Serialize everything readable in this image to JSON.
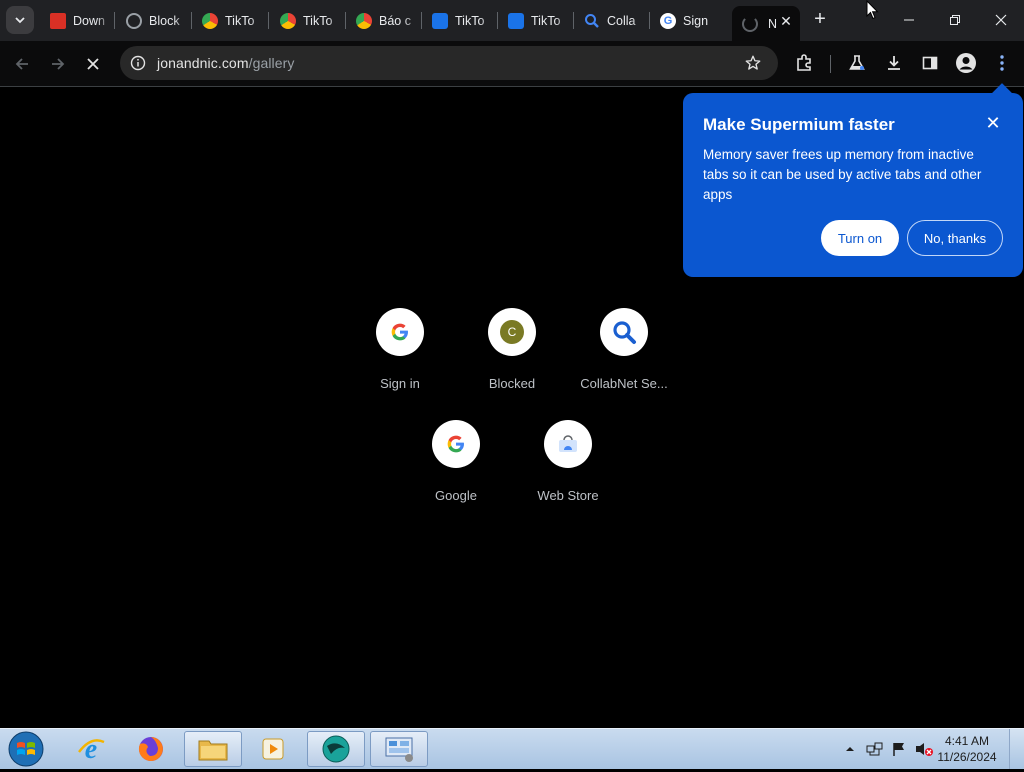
{
  "tabs": [
    {
      "title": "Down",
      "icon": "pdf-icon",
      "color": "#d93025"
    },
    {
      "title": "Block",
      "icon": "globe-icon",
      "color": "#9aa0a6"
    },
    {
      "title": "TikTo",
      "icon": "chrome-icon",
      "color": "#34a853"
    },
    {
      "title": "TikTo",
      "icon": "chrome-icon",
      "color": "#34a853"
    },
    {
      "title": "Báo c",
      "icon": "chrome-icon",
      "color": "#34a853"
    },
    {
      "title": "TikTo",
      "icon": "blue-app-icon",
      "color": "#1a73e8"
    },
    {
      "title": "TikTo",
      "icon": "blue-app-icon",
      "color": "#1a73e8"
    },
    {
      "title": "Colla",
      "icon": "search-icon",
      "color": "#4285f4"
    },
    {
      "title": "Sign",
      "icon": "google-icon",
      "color": "#ffffff"
    },
    {
      "title": "N",
      "icon": "loading-icon",
      "color": "#9aa0a6"
    }
  ],
  "toolbar": {
    "url_host": "jonandnic.com",
    "url_path": "/gallery"
  },
  "shortcuts": [
    {
      "label": "Sign in",
      "icon": "google-g-icon"
    },
    {
      "label": "Blocked",
      "icon": "letter-c-icon",
      "letter": "C"
    },
    {
      "label": "CollabNet Se...",
      "icon": "search-icon"
    },
    {
      "label": "Google",
      "icon": "google-g-icon"
    },
    {
      "label": "Web Store",
      "icon": "web-store-icon"
    }
  ],
  "bubble": {
    "title": "Make Supermium faster",
    "body": "Memory saver frees up memory from inactive tabs so it can be used by active tabs and other apps",
    "primary_button": "Turn on",
    "secondary_button": "No, thanks"
  },
  "taskbar": {
    "time": "4:41 AM",
    "date": "11/26/2024"
  },
  "colors": {
    "bubble_bg": "#0b57d0",
    "page_bg": "#000000",
    "chrome_bg": "#202124"
  }
}
